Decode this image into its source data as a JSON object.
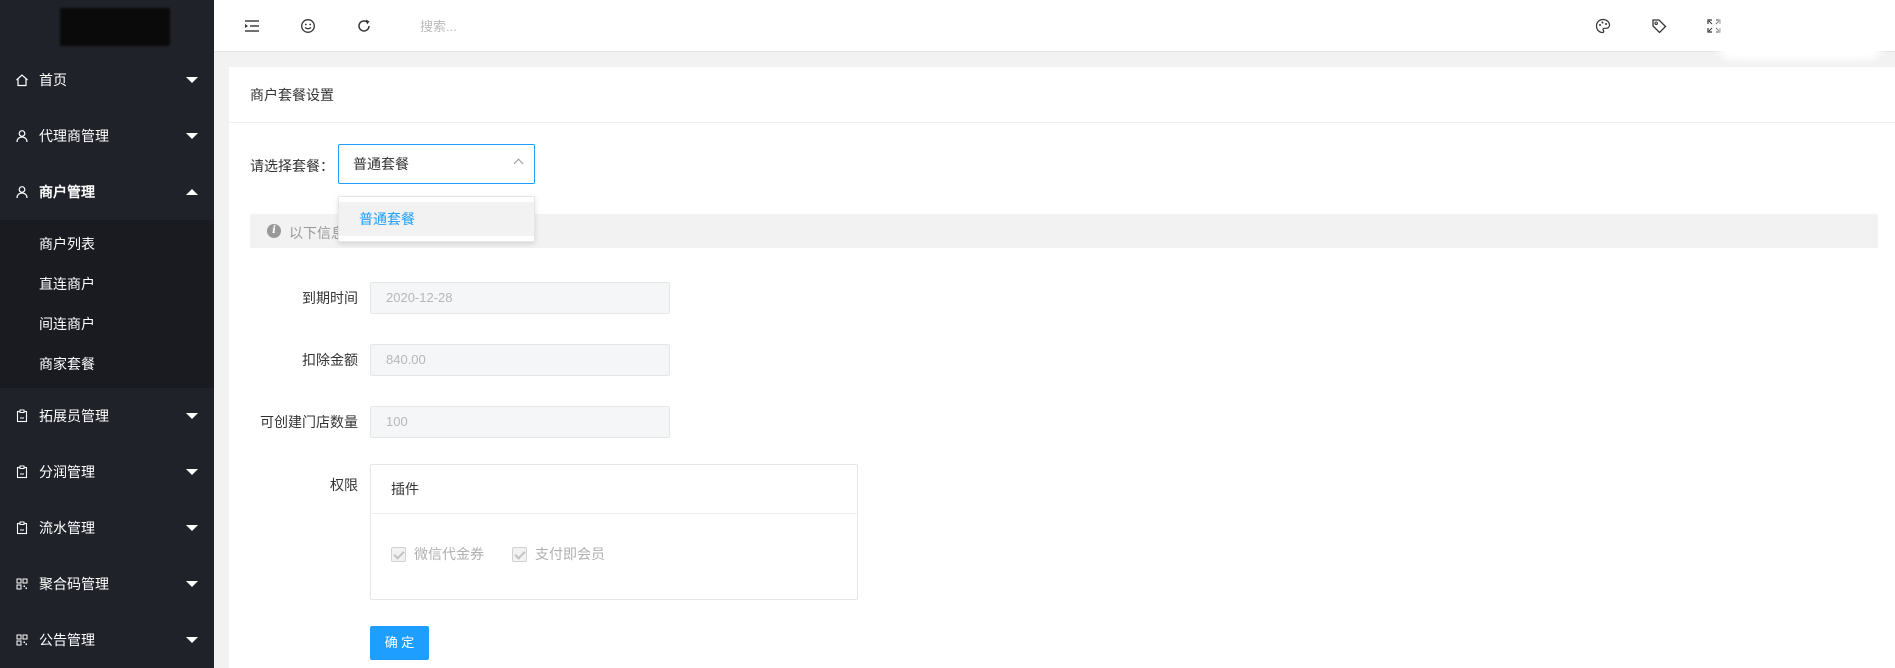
{
  "sidebar": {
    "items": [
      {
        "label": "首页",
        "icon": "home-icon"
      },
      {
        "label": "代理商管理",
        "icon": "user-icon"
      },
      {
        "label": "商户管理",
        "icon": "user-icon",
        "open": true,
        "children": [
          "商户列表",
          "直连商户",
          "间连商户",
          "商家套餐"
        ]
      },
      {
        "label": "拓展员管理",
        "icon": "clipboard-icon"
      },
      {
        "label": "分润管理",
        "icon": "clipboard-icon"
      },
      {
        "label": "流水管理",
        "icon": "clipboard-icon"
      },
      {
        "label": "聚合码管理",
        "icon": "qrcode-icon"
      },
      {
        "label": "公告管理",
        "icon": "qrcode-icon"
      }
    ]
  },
  "header": {
    "search_placeholder": "搜索...",
    "icons": [
      "menu-fold-icon",
      "emoji-icon",
      "refresh-icon",
      "palette-icon",
      "tag-icon",
      "fullscreen-icon"
    ]
  },
  "main": {
    "title": "商户套餐设置",
    "select_label": "请选择套餐：",
    "select_value": "普通套餐",
    "dropdown_options": [
      "普通套餐"
    ],
    "tip_text": "以下信息",
    "fields": [
      {
        "label": "到期时间",
        "value": "2020-12-28"
      },
      {
        "label": "扣除金额",
        "value": "840.00"
      },
      {
        "label": "可创建门店数量",
        "value": "100"
      }
    ],
    "perm_label": "权限",
    "perm_header": "插件",
    "perm_options": [
      "微信代金券",
      "支付即会员"
    ],
    "submit_label": "确 定"
  },
  "colors": {
    "sidebar_bg": "#20222a",
    "submenu_bg": "#191b21",
    "accent": "#1e9fff"
  }
}
